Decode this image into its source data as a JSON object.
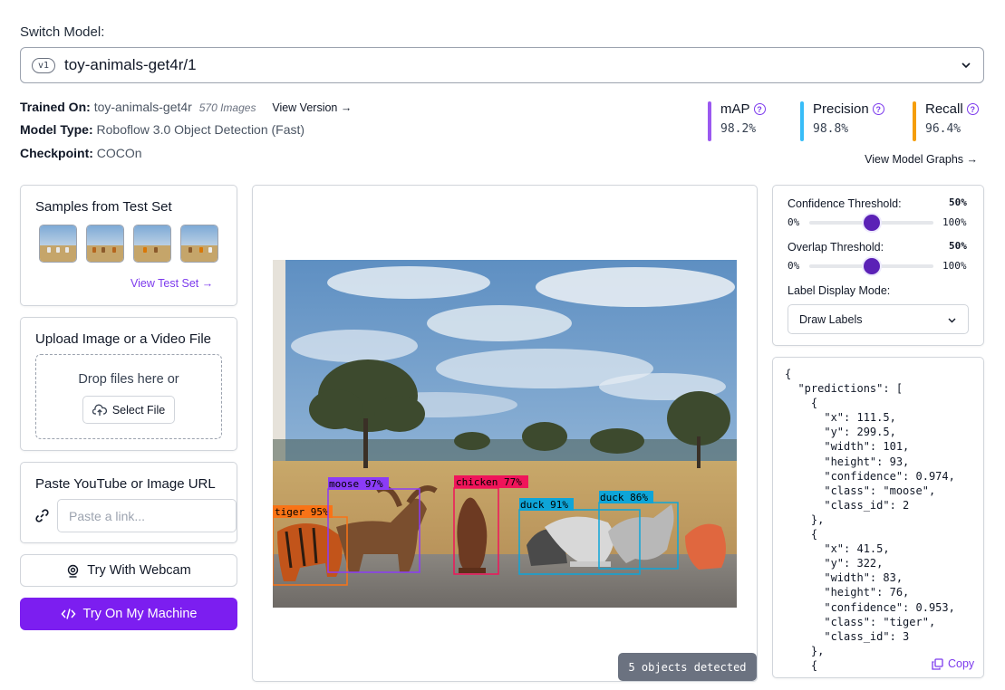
{
  "header": {
    "switch_label": "Switch Model:",
    "version_badge": "v1",
    "model_name": "toy-animals-get4r/1"
  },
  "meta": {
    "trained_on_label": "Trained On:",
    "trained_on_value": "toy-animals-get4r",
    "images_count": "570 Images",
    "view_version": "View Version →",
    "model_type_label": "Model Type:",
    "model_type_value": "Roboflow 3.0 Object Detection (Fast)",
    "checkpoint_label": "Checkpoint:",
    "checkpoint_value": "COCOn"
  },
  "metrics": [
    {
      "name": "mAP",
      "value": "98.2%",
      "color": "#9b59f0"
    },
    {
      "name": "Precision",
      "value": "98.8%",
      "color": "#38bdf8"
    },
    {
      "name": "Recall",
      "value": "96.4%",
      "color": "#f59e0b"
    }
  ],
  "view_graphs": "View Model Graphs →",
  "samples": {
    "title": "Samples from Test Set",
    "link": "View Test Set →"
  },
  "upload": {
    "title": "Upload Image or a Video File",
    "drop_text": "Drop files here or",
    "select_button": "Select File"
  },
  "paste": {
    "title": "Paste YouTube or Image URL",
    "placeholder": "Paste a link..."
  },
  "buttons": {
    "webcam": "Try With Webcam",
    "machine": "Try On My Machine"
  },
  "detections": [
    {
      "label": "tiger 95%",
      "color": "#f97316"
    },
    {
      "label": "moose 97%",
      "color": "#8b3cf7"
    },
    {
      "label": "chicken 77%",
      "color": "#f0145a"
    },
    {
      "label": "duck 91%",
      "color": "#0ea5d8"
    },
    {
      "label": "duck 86%",
      "color": "#0ea5d8"
    }
  ],
  "detected_badge": "5 objects detected",
  "controls": {
    "confidence_label": "Confidence Threshold:",
    "confidence_value": "50%",
    "overlap_label": "Overlap Threshold:",
    "overlap_value": "50%",
    "min": "0%",
    "max": "100%",
    "label_mode_label": "Label Display Mode:",
    "label_mode_value": "Draw Labels"
  },
  "json_lines": [
    "{",
    "  \"predictions\": [",
    "    {",
    "      \"x\": 111.5,",
    "      \"y\": 299.5,",
    "      \"width\": 101,",
    "      \"height\": 93,",
    "      \"confidence\": 0.974,",
    "      \"class\": \"moose\",",
    "      \"class_id\": 2",
    "    },",
    "    {",
    "      \"x\": 41.5,",
    "      \"y\": 322,",
    "      \"width\": 83,",
    "      \"height\": 76,",
    "      \"confidence\": 0.953,",
    "      \"class\": \"tiger\",",
    "      \"class_id\": 3",
    "    },",
    "    {"
  ],
  "copy_label": "Copy"
}
